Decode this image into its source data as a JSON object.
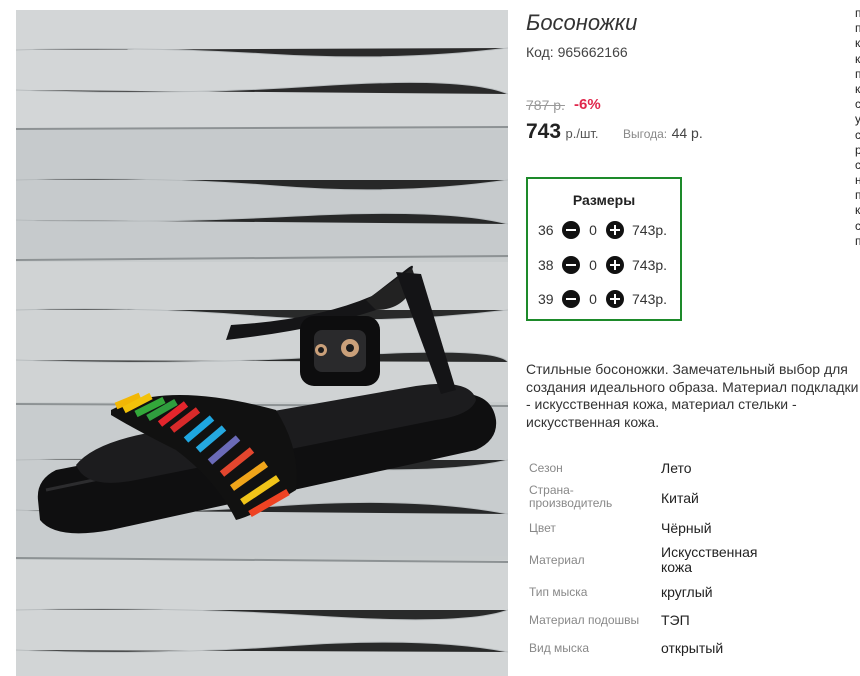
{
  "product": {
    "title": "Босоножки",
    "code": "Код: 965662166",
    "old_price": "787 р.",
    "discount": "-6%",
    "price": "743",
    "price_unit": "р./шт.",
    "benefit_label": "Выгода:",
    "benefit_value": "44 р."
  },
  "sizes": {
    "title": "Размеры",
    "rows": [
      {
        "size": "36",
        "qty": "0",
        "price": "743р."
      },
      {
        "size": "38",
        "qty": "0",
        "price": "743р."
      },
      {
        "size": "39",
        "qty": "0",
        "price": "743р."
      }
    ]
  },
  "description": "Стильные босоножки. Замечательный выбор для создания идеального образа. Материал подкладки - искусственная кожа, материал стельки - искусственная кожа.",
  "attributes": [
    {
      "label": "Сезон",
      "value": "Лето"
    },
    {
      "label": "Страна-производитель",
      "value": "Китай"
    },
    {
      "label": "Цвет",
      "value": "Чёрный"
    },
    {
      "label": "Материал",
      "value": "Искусственная кожа"
    },
    {
      "label": "Тип мыска",
      "value": "круглый"
    },
    {
      "label": "Материал подошвы",
      "value": "ТЭП"
    },
    {
      "label": "Вид мыска",
      "value": "открытый"
    }
  ],
  "edge_letters": [
    "п",
    "п",
    "к",
    "к",
    "п",
    "к",
    "с",
    "у",
    "с",
    "р",
    "с",
    "н",
    "п",
    "к",
    "с",
    "п"
  ],
  "colors": {
    "accent_red": "#e0264b",
    "sizes_border": "#1d8a2a"
  }
}
